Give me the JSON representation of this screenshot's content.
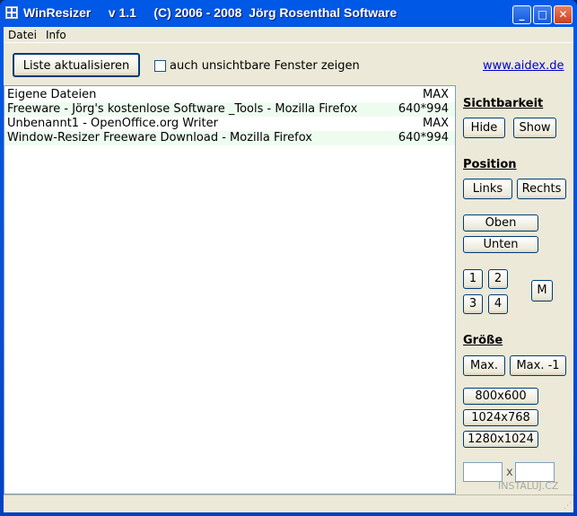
{
  "window": {
    "title": "WinResizer     v 1.1     (C) 2006 - 2008  Jörg Rosenthal Software"
  },
  "menu": [
    "Datei",
    "Info"
  ],
  "toolbar": {
    "refresh_label": "Liste aktualisieren",
    "checkbox_label": "auch unsichtbare Fenster zeigen",
    "checkbox_checked": false,
    "link": "www.aidex.de"
  },
  "list": [
    {
      "name": "Eigene Dateien",
      "size": "MAX"
    },
    {
      "name": "Freeware - Jörg's kostenlose Software _Tools - Mozilla Firefox",
      "size": "640*994"
    },
    {
      "name": "Unbenannt1 - OpenOffice.org Writer",
      "size": "MAX"
    },
    {
      "name": "Window-Resizer Freeware Download - Mozilla Firefox",
      "size": "640*994"
    }
  ],
  "panel": {
    "visibility": {
      "title": "Sichtbarkeit",
      "hide": "Hide",
      "show": "Show"
    },
    "position": {
      "title": "Position",
      "left": "Links",
      "right": "Rechts",
      "top": "Oben",
      "bottom": "Unten",
      "q1": "1",
      "q2": "2",
      "q3": "3",
      "q4": "4",
      "m": "M"
    },
    "size": {
      "title": "Größe",
      "max": "Max.",
      "max_minus": "Max. -1",
      "s1": "800x600",
      "s2": "1024x768",
      "s3": "1280x1024",
      "x": "x",
      "width_value": "",
      "height_value": ""
    }
  },
  "watermark": "INSTALUJ.CZ"
}
